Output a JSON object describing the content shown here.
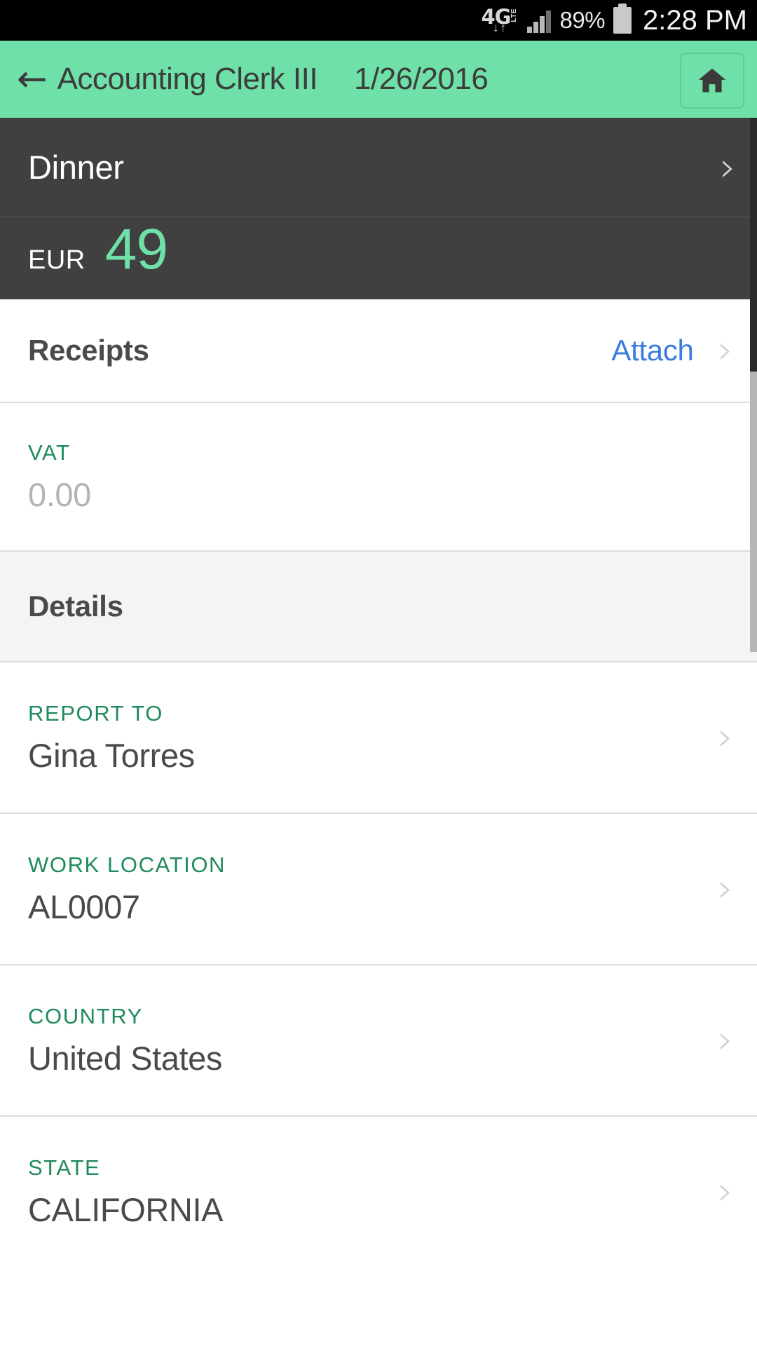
{
  "status_bar": {
    "network_type": "4G",
    "network_sub": "LTE",
    "data_arrows": "down-up",
    "signal_bars": 4,
    "battery_percent": "89%",
    "time": "2:28 PM"
  },
  "app_bar": {
    "back_icon": "arrow-left-icon",
    "title": "Accounting Clerk III",
    "date": "1/26/2016",
    "home_icon": "home-icon"
  },
  "expense": {
    "category": "Dinner",
    "category_chevron": "chevron-right-icon",
    "currency_code": "EUR",
    "amount": "49"
  },
  "receipts": {
    "label": "Receipts",
    "action": "Attach",
    "chevron": "chevron-right-icon"
  },
  "vat": {
    "label": "VAT",
    "value": "0.00"
  },
  "details": {
    "header": "Details",
    "fields": [
      {
        "label": "REPORT TO",
        "value": "Gina Torres",
        "chevron": "chevron-right-icon"
      },
      {
        "label": "WORK LOCATION",
        "value": "AL0007",
        "chevron": "chevron-right-icon"
      },
      {
        "label": "COUNTRY",
        "value": "United States",
        "chevron": "chevron-right-icon"
      },
      {
        "label": "STATE",
        "value": "CALIFORNIA",
        "chevron": "chevron-right-icon"
      }
    ]
  },
  "colors": {
    "accent_green": "#6fe0a8",
    "label_green": "#1f8a5c",
    "link_blue": "#3b7ddd",
    "dark_panel": "#404040",
    "status_bar": "#000000"
  }
}
